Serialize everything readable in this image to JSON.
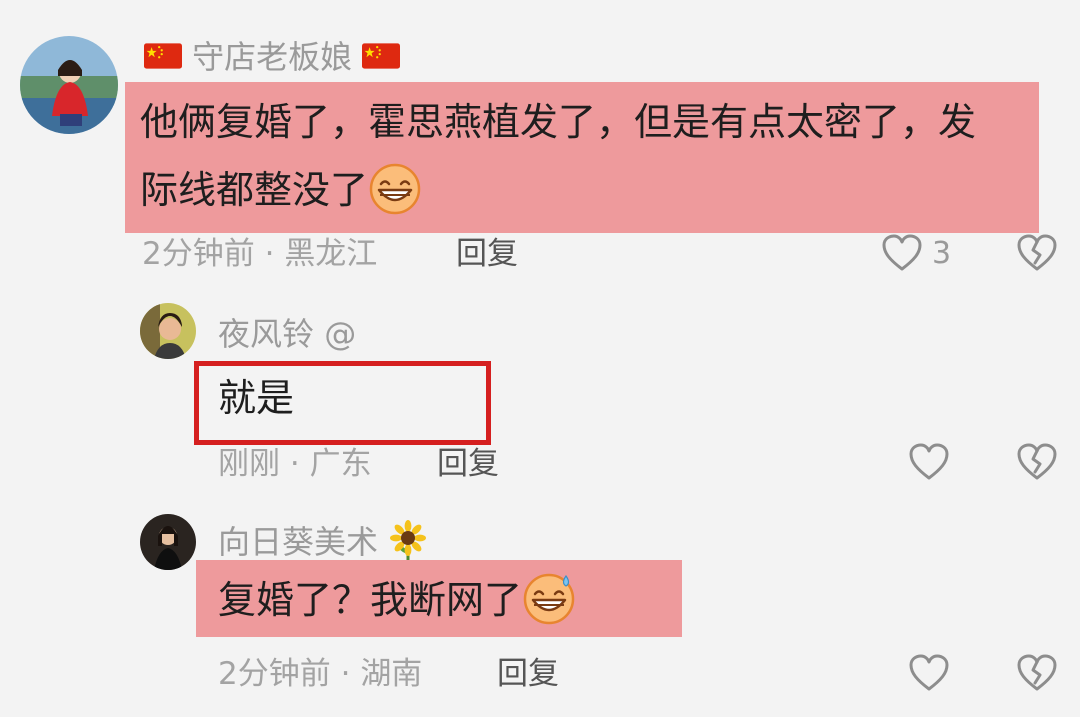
{
  "comments": [
    {
      "username": "守店老板娘",
      "text_line1": "他俩复婚了，霍思燕植发了，但是有点太密了，发",
      "text_line2": "际线都整没了",
      "time": "2分钟前",
      "location": "黑龙江",
      "reply_label": "回复",
      "like_count": "3"
    },
    {
      "username": "夜风铃",
      "mention": "@",
      "text": "就是",
      "time": "刚刚",
      "location": "广东",
      "reply_label": "回复"
    },
    {
      "username": "向日葵美术",
      "text": "复婚了？我断网了",
      "time": "2分钟前",
      "location": "湖南",
      "reply_label": "回复"
    }
  ],
  "separator": "·",
  "colors": {
    "highlight": "#ee9a9c",
    "annotation_box": "#d51f1f",
    "background": "#f3f3f3"
  },
  "icons": {
    "like": "heart-outline-icon",
    "dislike": "broken-heart-icon",
    "flag": "china-flag-icon",
    "grin": "grinning-emoji-icon",
    "sweat": "sweat-smile-emoji-icon",
    "sunflower": "sunflower-icon"
  }
}
